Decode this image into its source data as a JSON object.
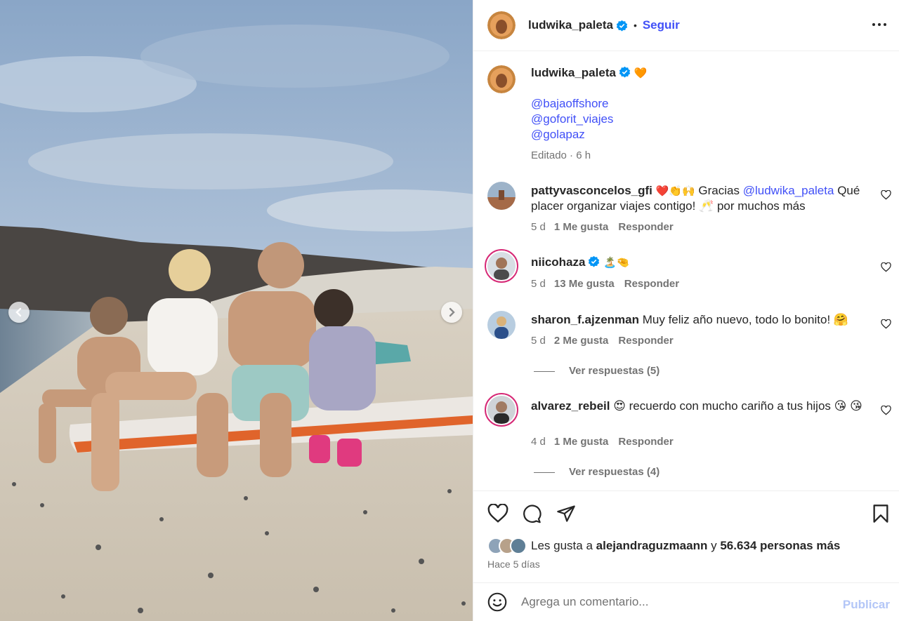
{
  "post": {
    "author": "ludwika_paleta",
    "follow_label": "Seguir",
    "header_separator": "•",
    "caption_emoji": "🧡",
    "caption_mentions": [
      "@bajaoffshore",
      "@goforit_viajes",
      "@golapaz"
    ],
    "caption_meta": "Editado · 6 h"
  },
  "comments": [
    {
      "username": "pattyvasconcelos_gfi",
      "verified": false,
      "text_emoji": "❤️👏🙌",
      "text_a": "Gracias",
      "mention": "@ludwika_paleta",
      "text_b": "Qué placer organizar viajes contigo! 🥂 por muchos más",
      "age": "5 d",
      "likes": "1 Me gusta",
      "reply": "Responder"
    },
    {
      "username": "niicohaza",
      "verified": true,
      "text": "🏝️🤏",
      "age": "5 d",
      "likes": "13 Me gusta",
      "reply": "Responder"
    },
    {
      "username": "sharon_f.ajzenman",
      "verified": false,
      "text": "Muy feliz año nuevo, todo lo bonito! 🤗",
      "age": "5 d",
      "likes": "2 Me gusta",
      "reply": "Responder",
      "view_replies": "Ver respuestas (5)"
    },
    {
      "username": "alvarez_rebeil",
      "verified": false,
      "text": "😍 recuerdo con mucho cariño a tus hijos 😘 😘",
      "age": "4 d",
      "likes": "1 Me gusta",
      "reply": "Responder",
      "view_replies": "Ver respuestas (4)"
    }
  ],
  "footer": {
    "likes_prefix": "Les gusta a",
    "liker": "alejandraguzmaann",
    "likes_joiner": "y",
    "likes_rest": "56.634 personas más",
    "posted": "Hace 5 días",
    "comment_placeholder": "Agrega un comentario...",
    "publish_label": "Publicar"
  },
  "icons": {
    "header_more": "more-horizontal-icon",
    "verified": "verified-badge-icon",
    "carousel_prev": "chevron-left-icon",
    "carousel_next": "chevron-right-icon",
    "like": "heart-icon",
    "comment": "comment-bubble-icon",
    "share": "paper-plane-icon",
    "save": "bookmark-icon",
    "emoji": "smiley-icon"
  },
  "colors": {
    "link": "#4150f7",
    "verified": "#0095f6",
    "muted": "#737373",
    "publish_disabled": "#b3c6f7",
    "story_ring": "#d62976"
  }
}
